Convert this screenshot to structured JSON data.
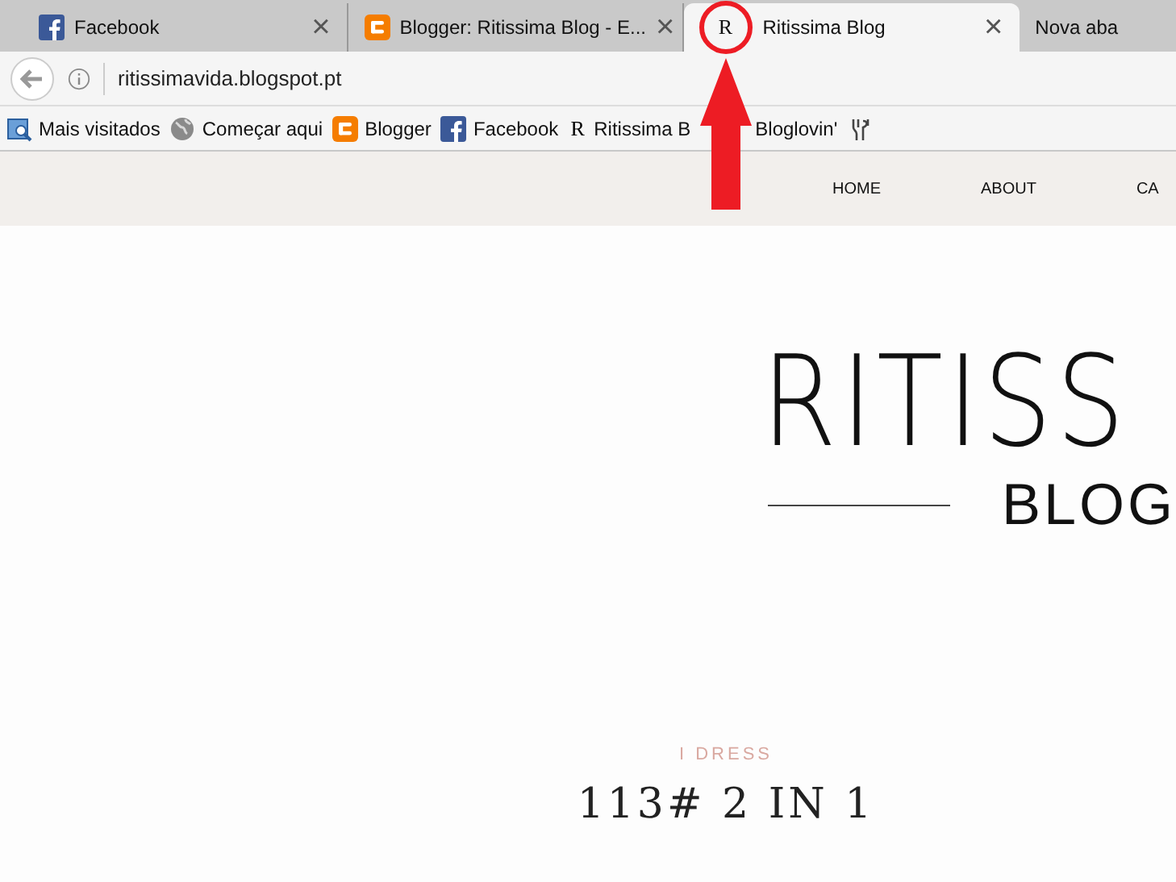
{
  "tabs": [
    {
      "kind": "facebook",
      "label": "Facebook",
      "selected": false,
      "close": "×"
    },
    {
      "kind": "blogger",
      "label": "Blogger: Ritissima Blog - E...",
      "selected": false,
      "close": "×"
    },
    {
      "kind": "letter",
      "icon_text": "R",
      "label": "Ritissima Blog",
      "selected": true,
      "close": "×"
    },
    {
      "kind": "none",
      "label": "Nova aba",
      "selected": false
    }
  ],
  "address_bar": {
    "url": "ritissimavida.blogspot.pt"
  },
  "bookmarks": [
    {
      "kind": "visited",
      "label": "Mais visitados"
    },
    {
      "kind": "globe",
      "label": "Começar aqui"
    },
    {
      "kind": "blogger",
      "label": "Blogger"
    },
    {
      "kind": "facebook",
      "label": "Facebook"
    },
    {
      "kind": "letter",
      "icon_text": "R",
      "label": "Ritissima B"
    },
    {
      "kind": "plain",
      "label": "Bloglovin'"
    },
    {
      "kind": "tf"
    }
  ],
  "nav": [
    "HOME",
    "ABOUT",
    "CA"
  ],
  "logo": {
    "title": "RITISS",
    "subtitle": "BLOG"
  },
  "post": {
    "category": "I DRESS",
    "title": "113# 2 IN 1"
  }
}
